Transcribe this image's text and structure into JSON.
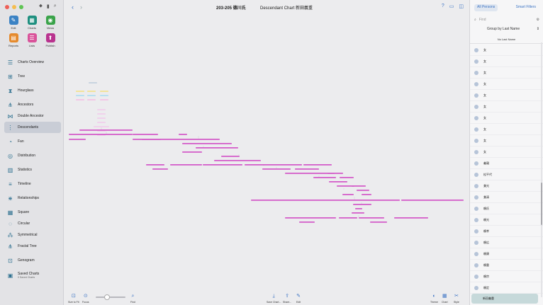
{
  "window": {
    "doc_title": "203-205 德川氏",
    "chart_title": "Descendant Chart 新田義重"
  },
  "toolbar_tools": [
    {
      "label": "Edit",
      "icon": "pencil-icon",
      "glyph": "✎",
      "color": "#3b82c4"
    },
    {
      "label": "Charts",
      "icon": "charts-icon",
      "glyph": "▦",
      "color": "#1e8f7f"
    },
    {
      "label": "Views",
      "icon": "eye-icon",
      "glyph": "◉",
      "color": "#3aa34a"
    },
    {
      "label": "Reports",
      "icon": "reports-icon",
      "glyph": "▤",
      "color": "#e58a2d"
    },
    {
      "label": "Lists",
      "icon": "lists-icon",
      "glyph": "☰",
      "color": "#d9539a"
    },
    {
      "label": "Publish",
      "icon": "publish-icon",
      "glyph": "⬆",
      "color": "#b9338f"
    }
  ],
  "nav": [
    {
      "label": "Charts Overview",
      "icon": "charts-overview-icon",
      "glyph": "☰",
      "gap": false
    },
    {
      "label": "Tree",
      "icon": "tree-icon",
      "glyph": "⊞",
      "gap": true
    },
    {
      "label": "Hourglass",
      "icon": "hourglass-icon",
      "glyph": "⧗",
      "gap": true
    },
    {
      "label": "Ancestors",
      "icon": "ancestors-icon",
      "glyph": "⋔",
      "gap": true
    },
    {
      "label": "Double Ancestor",
      "icon": "double-ancestor-icon",
      "glyph": "⋈",
      "gap": false
    },
    {
      "label": "Descendants",
      "icon": "descendants-icon",
      "glyph": "⋮",
      "gap": false,
      "active": true
    },
    {
      "label": "Fan",
      "icon": "fan-icon",
      "glyph": "◔",
      "gap": true
    },
    {
      "label": "Distribution",
      "icon": "distribution-icon",
      "glyph": "◎",
      "gap": true
    },
    {
      "label": "Statistics",
      "icon": "statistics-icon",
      "glyph": "▥",
      "gap": true
    },
    {
      "label": "Timeline",
      "icon": "timeline-icon",
      "glyph": "≡",
      "gap": true
    },
    {
      "label": "Relationships",
      "icon": "relationships-icon",
      "glyph": "⋇",
      "gap": true
    },
    {
      "label": "Square",
      "icon": "square-icon",
      "glyph": "▦",
      "gap": true
    },
    {
      "label": "Circular",
      "icon": "circular-icon",
      "glyph": "◌",
      "gap": false
    },
    {
      "label": "Symmetrical",
      "icon": "symmetrical-icon",
      "glyph": "⁂",
      "gap": false
    },
    {
      "label": "Fractal Tree",
      "icon": "fractal-tree-icon",
      "glyph": "⋔",
      "gap": false
    },
    {
      "label": "Genogram",
      "icon": "genogram-icon",
      "glyph": "⊡",
      "gap": true
    }
  ],
  "saved": {
    "label": "Saved Charts",
    "sub": "0 Saved Charts"
  },
  "bottom_tools": [
    {
      "label": "Size to Fit",
      "glyph": "⊡"
    },
    {
      "label": "Focus",
      "glyph": "⊙"
    },
    {
      "label": "Find",
      "glyph": "⌕"
    },
    {
      "label": "Save Chart...",
      "glyph": "⤓"
    },
    {
      "label": "Share...",
      "glyph": "⇪"
    },
    {
      "label": "Edit",
      "glyph": "✎"
    },
    {
      "label": "Theme",
      "glyph": "◐"
    },
    {
      "label": "Chart",
      "glyph": "▦"
    },
    {
      "label": "Style",
      "glyph": "✂"
    }
  ],
  "right_panel": {
    "tab_all": "All Persons",
    "tab_smart": "Smart Filters",
    "find_placeholder": "Find",
    "group_by": "Group by Last Name",
    "section_header": "No Last Name",
    "rows": [
      "女",
      "女",
      "女",
      "女",
      "女",
      "女",
      "女",
      "女",
      "女",
      "女",
      "義親",
      "松平代",
      "兼光",
      "兼清",
      "頼氏",
      "頼光",
      "頼孝",
      "頼広",
      "頼康",
      "頼重",
      "頼宗",
      "頼定"
    ],
    "selected": "新田義重"
  },
  "colors": {
    "accent": "#3b73c4",
    "box_magenta": "#d35ac8",
    "box_light": "#f0d2ec"
  }
}
